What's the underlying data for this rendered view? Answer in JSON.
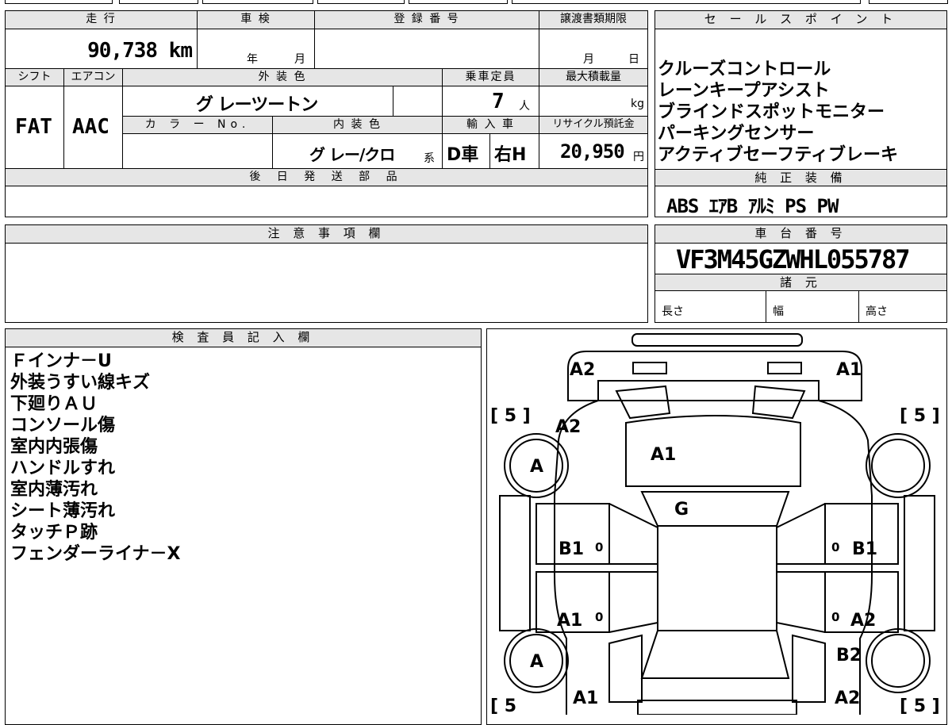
{
  "top_table": {
    "mileage_label": "走 行",
    "mileage": "90,738 km",
    "shaken_label": "車 検",
    "shaken_year": "年",
    "shaken_month": "月",
    "reg_label": "登 録 番 号",
    "transfer_label": "譲渡書類期限",
    "transfer_month": "月",
    "transfer_day": "日",
    "shift_label": "シフト",
    "shift": "FAT",
    "ac_label": "エアコン",
    "ac": "AAC",
    "ext_color_label": "外 装 色",
    "ext_color": "グ レーツートン",
    "capacity_label": "乗車定員",
    "capacity": "7",
    "capacity_unit": "人",
    "load_label": "最大積載量",
    "load_unit": "kg",
    "color_no_label": "カ ラ ー No.",
    "int_color_label": "内 装 色",
    "int_color": "グ レー/クロ",
    "int_color_suffix": "系",
    "import_label": "輸 入 車",
    "import_value": "D車",
    "handle": "右H",
    "recycle_label": "リサイクル預託金",
    "recycle_amount": "20,950",
    "recycle_unit": "円",
    "later_parts_label": "後 日 発 送 部 品"
  },
  "sales_points": {
    "label": "セ ー ル ス ポ イ ン ト",
    "items": [
      "クルーズコントロール",
      "レーンキープアシスト",
      "ブラインドスポットモニター",
      "パーキングセンサー",
      "アクティブセーフティブレーキ"
    ]
  },
  "standard_equipment": {
    "label": "純 正 装 備",
    "items": "ABS ｴｱB ｱﾙﾐ PS PW"
  },
  "notes": {
    "label": "注 意 事 項 欄"
  },
  "chassis": {
    "label": "車 台 番 号",
    "number": "VF3M45GZWHL055787",
    "specs_label": "諸 元",
    "length_label": "長さ",
    "width_label": "幅",
    "height_label": "高さ"
  },
  "inspector": {
    "label": "検 査 員 記 入 欄",
    "lines": [
      "Ｆインナ－U",
      "外装うすい線キズ",
      "下廻りＡＵ",
      "コンソール傷",
      "室内内張傷",
      "ハンドルすれ",
      "室内薄汚れ",
      "シート薄汚れ",
      "タッチＰ跡",
      "フェンダーライナ－X"
    ]
  },
  "diagram": {
    "marks": {
      "front_left": "A2",
      "front_right": "A1",
      "fender_left": "A2",
      "hood": "A1",
      "windshield": "G",
      "front_door_left": "B1",
      "front_door_right": "B1",
      "rear_door_left": "A1",
      "rear_door_right": "A2",
      "quarter_right": "B2",
      "rear_left": "A1",
      "rear_right": "A2",
      "wheel_front_left": "A",
      "wheel_rear_left": "A",
      "tire_fl": "[ 5 ]",
      "tire_fr": "[ 5 ]",
      "tire_rl": "[ 5",
      "tire_rr": "[ 5 ]",
      "zero": "0"
    }
  }
}
